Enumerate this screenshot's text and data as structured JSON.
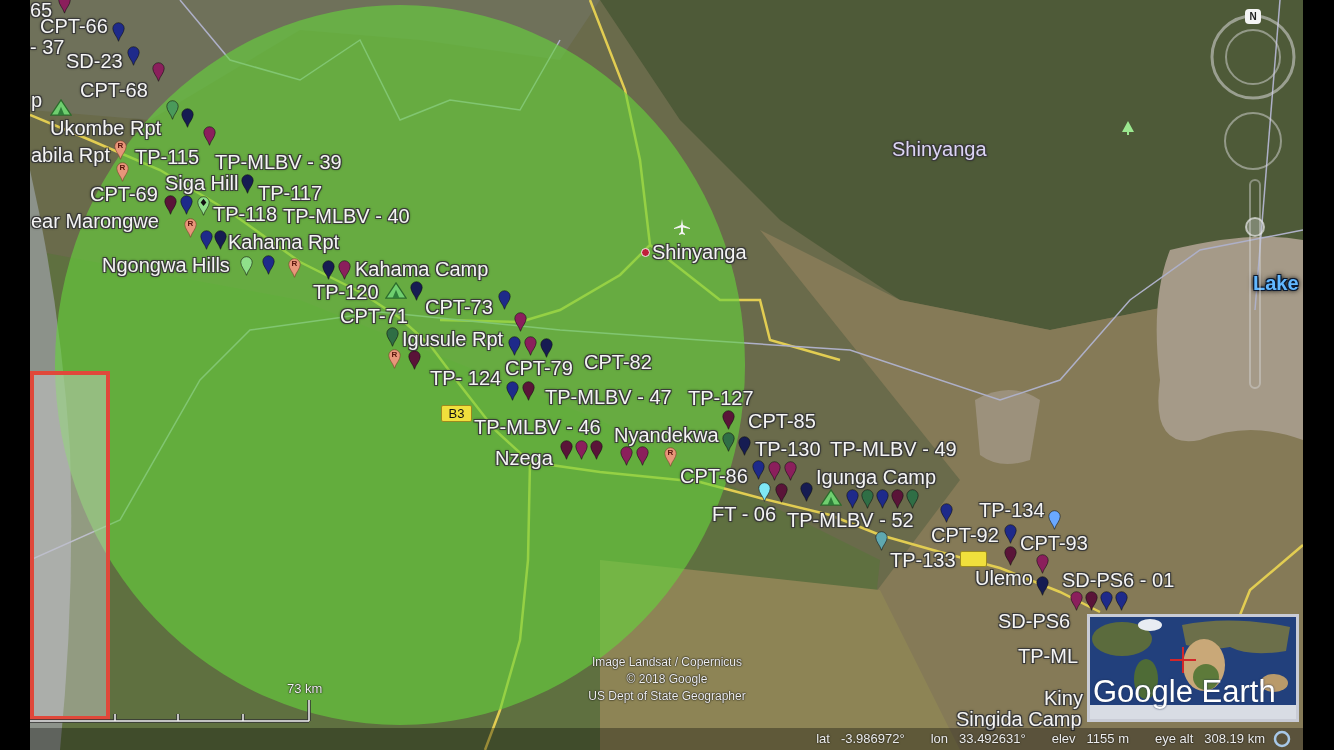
{
  "map": {
    "placemark_labels": [
      "65",
      "CPT-66",
      "- 37",
      "SD-23",
      "p",
      "CPT-68",
      "Ukombe Rpt",
      "abila Rpt",
      "TP-115",
      "TP-MLBV - 39",
      "CPT-69",
      "Siga Hill",
      "TP-117",
      "ear Marongwe",
      "TP-118",
      "TP-MLBV - 40",
      "Kahama Rpt",
      "Ngongwa Hills",
      "Kahama Camp",
      "TP-120",
      "CPT-71",
      "CPT-73",
      "Igusule Rpt",
      "TP- 124",
      "CPT-79",
      "CPT-82",
      "TP-MLBV - 47",
      "TP-127",
      "TP-MLBV - 46",
      "Nyandekwa",
      "CPT-85",
      "Nzega",
      "TP-130",
      "TP-MLBV - 49",
      "CPT-86",
      "Igunga Camp",
      "FT - 06",
      "TP-MLBV - 52",
      "TP-134",
      "CPT-92",
      "TP-133",
      "CPT-93",
      "Ulemo",
      "SD-PS6 - 01",
      "SD-PS6",
      "TP-ML",
      "Kiny",
      "Singida Camp"
    ],
    "place_names": [
      {
        "kind": "region",
        "text": "Shinyanga"
      },
      {
        "kind": "town",
        "text": "Shinyanga"
      },
      {
        "kind": "water",
        "text": "Lake"
      }
    ],
    "road_shields": [
      {
        "text": "B3"
      }
    ],
    "placemarks": [
      {
        "kind": "balloon",
        "color": "#8b1f5c"
      },
      {
        "kind": "balloon",
        "color": "#1e2a8a"
      },
      {
        "kind": "balloon",
        "color": "#1e2a8a"
      },
      {
        "kind": "balloon",
        "color": "#8b1f5c"
      },
      {
        "kind": "camp"
      },
      {
        "kind": "balloon",
        "color": "#4a9a5a"
      },
      {
        "kind": "balloon",
        "color": "#161c52"
      },
      {
        "kind": "repeater",
        "letter": "R"
      },
      {
        "kind": "balloon",
        "color": "#8b1f5c"
      },
      {
        "kind": "repeater",
        "letter": "R"
      },
      {
        "kind": "balloon",
        "color": "#161c52"
      },
      {
        "kind": "balloon",
        "color": "#5a1438"
      },
      {
        "kind": "balloon",
        "color": "#1e2a8a"
      },
      {
        "kind": "repeater",
        "letter": "R"
      },
      {
        "kind": "diamond",
        "color": "#8fe08a"
      },
      {
        "kind": "balloon",
        "color": "#1e2a8a"
      },
      {
        "kind": "balloon",
        "color": "#161c52"
      },
      {
        "kind": "balloon",
        "color": "#1e2a8a"
      },
      {
        "kind": "balloon",
        "color": "#8fe08a"
      },
      {
        "kind": "repeater",
        "letter": "R"
      },
      {
        "kind": "balloon",
        "color": "#161c52"
      },
      {
        "kind": "balloon",
        "color": "#8b1f5c"
      },
      {
        "kind": "camp"
      },
      {
        "kind": "balloon",
        "color": "#161c52"
      },
      {
        "kind": "balloon",
        "color": "#1e2a8a"
      },
      {
        "kind": "balloon",
        "color": "#2f6e45"
      },
      {
        "kind": "balloon",
        "color": "#8b1f5c"
      },
      {
        "kind": "repeater",
        "letter": "R"
      },
      {
        "kind": "balloon",
        "color": "#5a1438"
      },
      {
        "kind": "balloon",
        "color": "#1e2a8a"
      },
      {
        "kind": "balloon",
        "color": "#8b1f5c"
      },
      {
        "kind": "balloon",
        "color": "#161c52"
      },
      {
        "kind": "balloon",
        "color": "#1e2a8a"
      },
      {
        "kind": "balloon",
        "color": "#5a1438"
      },
      {
        "kind": "balloon",
        "color": "#5a1438"
      },
      {
        "kind": "balloon",
        "color": "#8b1f5c"
      },
      {
        "kind": "balloon",
        "color": "#5a1438"
      },
      {
        "kind": "balloon",
        "color": "#8b1f5c"
      },
      {
        "kind": "balloon",
        "color": "#8b1f5c"
      },
      {
        "kind": "balloon",
        "color": "#5a1438"
      },
      {
        "kind": "balloon",
        "color": "#2f6e45"
      },
      {
        "kind": "balloon",
        "color": "#161c52"
      },
      {
        "kind": "balloon",
        "color": "#1e2a8a"
      },
      {
        "kind": "repeater",
        "letter": "R"
      },
      {
        "kind": "balloon",
        "color": "#8b1f5c"
      },
      {
        "kind": "balloon",
        "color": "#8b1f5c"
      },
      {
        "kind": "balloon",
        "color": "#7fe8f5"
      },
      {
        "kind": "balloon",
        "color": "#161c52"
      },
      {
        "kind": "balloon",
        "color": "#5a1438"
      },
      {
        "kind": "camp"
      },
      {
        "kind": "balloon",
        "color": "#1e2a8a"
      },
      {
        "kind": "balloon",
        "color": "#2f6e45"
      },
      {
        "kind": "balloon",
        "color": "#1e2a8a"
      },
      {
        "kind": "balloon",
        "color": "#5a1438"
      },
      {
        "kind": "balloon",
        "color": "#2f6e45"
      },
      {
        "kind": "balloon",
        "color": "#5fa8b0"
      },
      {
        "kind": "balloon",
        "color": "#1e2a8a"
      },
      {
        "kind": "balloon",
        "color": "#1e2a8a"
      },
      {
        "kind": "balloon",
        "color": "#6aa8ff"
      },
      {
        "kind": "balloon",
        "color": "#5a1438"
      },
      {
        "kind": "balloon",
        "color": "#8b1f5c"
      },
      {
        "kind": "balloon",
        "color": "#161c52"
      },
      {
        "kind": "balloon",
        "color": "#8b1f5c"
      },
      {
        "kind": "balloon",
        "color": "#5a1438"
      },
      {
        "kind": "balloon",
        "color": "#1e2a8a"
      },
      {
        "kind": "balloon",
        "color": "#1e2a8a"
      },
      {
        "kind": "tree"
      }
    ]
  },
  "navigation": {
    "compass": {
      "letter": "N"
    },
    "zoom_slider": {
      "level": 0.8
    }
  },
  "scale_bar": {
    "label": "73 km"
  },
  "credits": [
    "Image Landsat / Copernicus",
    "© 2018 Google",
    "US Dept of State Geographer"
  ],
  "overview": {
    "logo": "Google Earth"
  },
  "status_bar": [
    {
      "label": "lat",
      "value": "-3.986972°"
    },
    {
      "label": "lon",
      "value": "33.492631°"
    },
    {
      "label": "elev",
      "value": "1155 m"
    },
    {
      "label": "eye alt",
      "value": "308.19 km"
    }
  ]
}
